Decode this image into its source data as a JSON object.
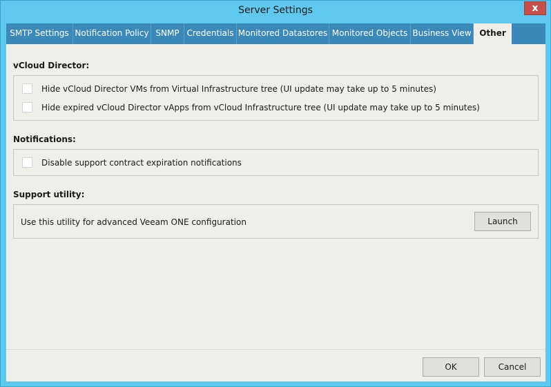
{
  "window": {
    "title": "Server Settings",
    "close_glyph": "x"
  },
  "tabs": [
    {
      "label": "SMTP Settings"
    },
    {
      "label": "Notification Policy"
    },
    {
      "label": "SNMP"
    },
    {
      "label": "Credentials"
    },
    {
      "label": "Monitored Datastores"
    },
    {
      "label": "Monitored Objects"
    },
    {
      "label": "Business View"
    },
    {
      "label": "Other",
      "active": true
    }
  ],
  "vcloud": {
    "heading": "vCloud Director:",
    "options": [
      {
        "label": "Hide vCloud Director VMs from Virtual Infrastructure tree (UI update may take up to 5 minutes)",
        "checked": false
      },
      {
        "label": "Hide expired vCloud Director vApps from vCloud Infrastructure tree (UI update may take up to 5 minutes)",
        "checked": false
      }
    ]
  },
  "notifications": {
    "heading": "Notifications:",
    "options": [
      {
        "label": "Disable support contract expiration notifications",
        "checked": false
      }
    ]
  },
  "support": {
    "heading": "Support utility:",
    "description": "Use this utility for advanced Veeam ONE configuration",
    "launch_label": "Launch"
  },
  "footer": {
    "ok_label": "OK",
    "cancel_label": "Cancel"
  },
  "colors": {
    "titlebar": "#5ec8ee",
    "tabstrip": "#3b89b8",
    "client": "#f0eee9",
    "close_button": "#c7504a"
  }
}
